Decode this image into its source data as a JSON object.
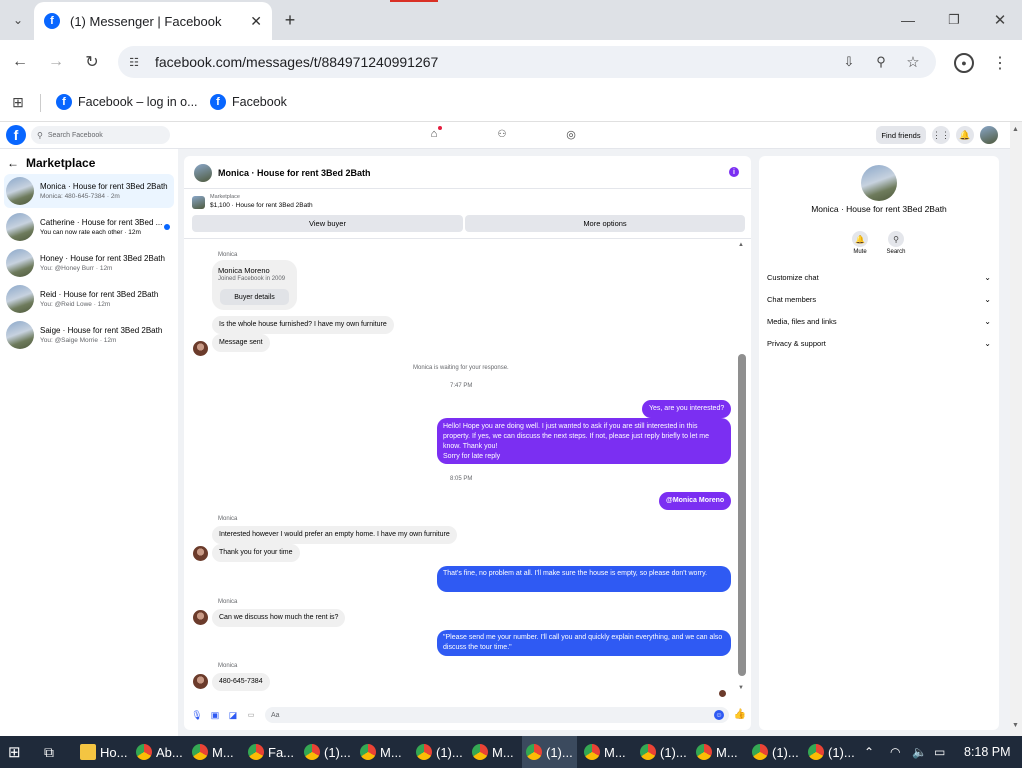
{
  "browser": {
    "tab_title": "(1) Messenger | Facebook",
    "url": "facebook.com/messages/t/884971240991267",
    "bookmarks": [
      "Facebook – log in o...",
      "Facebook"
    ]
  },
  "fb": {
    "search_placeholder": "Search Facebook",
    "find_friends": "Find friends"
  },
  "sidebar": {
    "title": "Marketplace",
    "items": [
      {
        "name": "Monica · House for rent 3Bed 2Bath",
        "preview": "Monica: 480-645-7384 · 2m"
      },
      {
        "name": "Catherine · House for rent 3Bed ...",
        "preview": "You can now rate each other · 12m"
      },
      {
        "name": "Honey · House for rent 3Bed 2Bath",
        "preview": "You: @Honey Burr · 12m"
      },
      {
        "name": "Reid · House for rent 3Bed 2Bath",
        "preview": "You: @Reid Lowe · 12m"
      },
      {
        "name": "Saige · House for rent 3Bed 2Bath",
        "preview": "You: @Saige Morrie · 12m"
      }
    ]
  },
  "chat": {
    "title": "Monica · House for rent 3Bed 2Bath",
    "market_label": "Marketplace",
    "listing": "$1,100 · House for rent 3Bed 2Bath",
    "view_buyer": "View buyer",
    "more_options": "More options",
    "sender": "Monica",
    "profile_name": "Monica Moreno",
    "profile_joined": "Joined Facebook in 2009",
    "buyer_details": "Buyer details",
    "m1": "Is the whole house furnished? I have my own furniture",
    "m2": "Message sent",
    "waiting": "Monica is waiting for your response.",
    "time1": "7:47 PM",
    "o1": "Yes, are you interested?",
    "o2": "Hello! Hope you are doing well. I just wanted to ask if you are still interested in this property. If yes, we can discuss the next steps. If not, please just reply briefly to let me know. Thank you!",
    "o2b": "Sorry for late reply",
    "time2": "8:05 PM",
    "o3": "@Monica Moreno",
    "m3": "Interested however I would prefer an empty home. I have my own furniture",
    "m4": "Thank you for your time",
    "o4": "That's fine, no problem at all. I'll make sure the house is empty, so please don't worry.",
    "m5": "Can we discuss how much the rent is?",
    "o5": "\"Please send me your number. I'll call you and quickly explain everything, and we can also discuss the tour time.\"",
    "m6": "480-645-7384",
    "input_placeholder": "Aa"
  },
  "info": {
    "title": "Monica · House for rent 3Bed 2Bath",
    "mute": "Mute",
    "search": "Search",
    "sections": [
      "Customize chat",
      "Chat members",
      "Media, files and links",
      "Privacy & support"
    ]
  },
  "taskbar": {
    "time": "8:18 PM",
    "apps": [
      "Ho...",
      "Ab...",
      "M...",
      "Fa...",
      "(1)...",
      "M...",
      "(1)...",
      "M...",
      "(1)...",
      "M...",
      "(1)...",
      "M...",
      "(1)...",
      "(1)..."
    ]
  },
  "colors": {
    "fb_blue": "#0866ff",
    "outgoing_purple": "#7b2ff2",
    "outgoing_blue": "#2f5af3"
  }
}
